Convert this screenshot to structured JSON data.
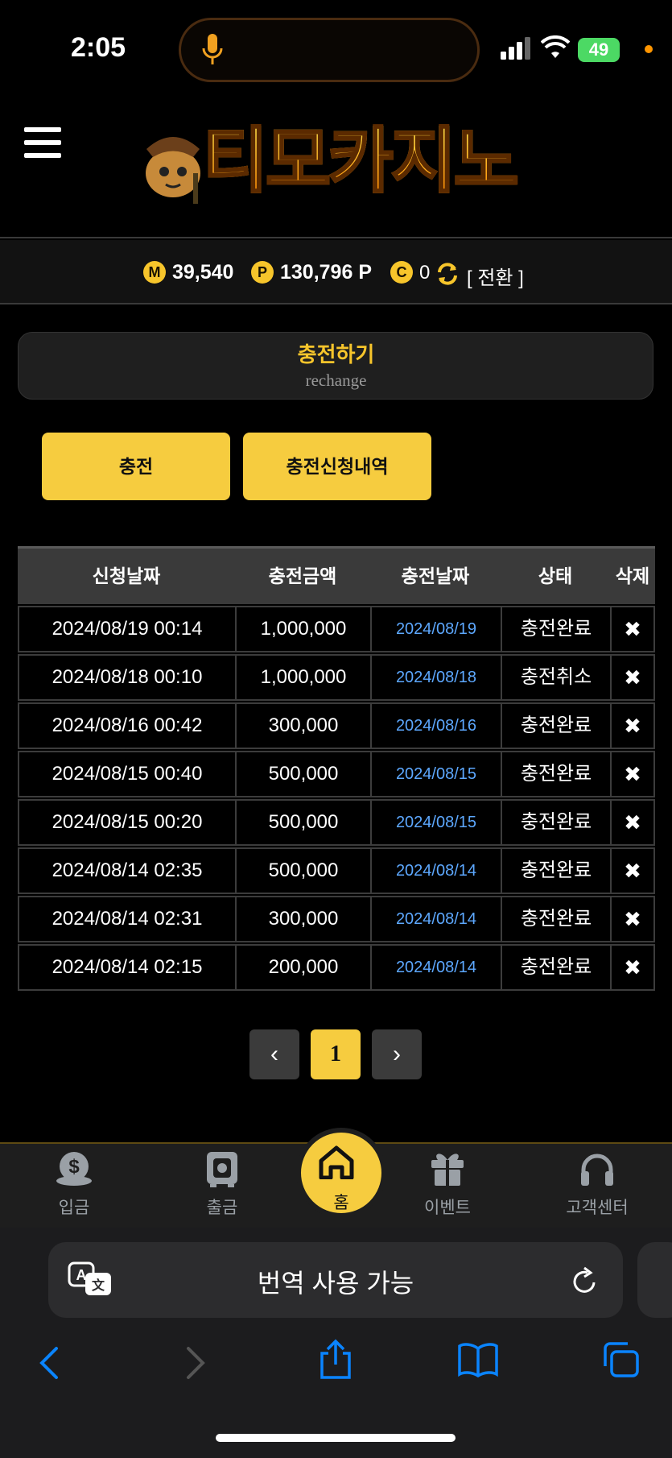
{
  "status": {
    "time": "2:05",
    "battery": "49"
  },
  "header": {
    "logo_text": "티모카지노"
  },
  "wallet": {
    "money_icon": "M",
    "money": "39,540",
    "point_icon": "P",
    "point": "130,796 P",
    "casino_icon": "C",
    "casino": "0",
    "convert": "[ 전환 ]"
  },
  "section": {
    "title": "충전하기",
    "subtitle": "rechange"
  },
  "buttons": {
    "charge": "충전",
    "history": "충전신청내역"
  },
  "table": {
    "headers": [
      "신청날짜",
      "충전금액",
      "충전날짜",
      "상태",
      "삭제"
    ],
    "rows": [
      {
        "req": "2024/08/19 00:14",
        "amount": "1,000,000",
        "date": "2024/08/19",
        "status": "충전완료"
      },
      {
        "req": "2024/08/18 00:10",
        "amount": "1,000,000",
        "date": "2024/08/18",
        "status": "충전취소"
      },
      {
        "req": "2024/08/16 00:42",
        "amount": "300,000",
        "date": "2024/08/16",
        "status": "충전완료"
      },
      {
        "req": "2024/08/15 00:40",
        "amount": "500,000",
        "date": "2024/08/15",
        "status": "충전완료"
      },
      {
        "req": "2024/08/15 00:20",
        "amount": "500,000",
        "date": "2024/08/15",
        "status": "충전완료"
      },
      {
        "req": "2024/08/14 02:35",
        "amount": "500,000",
        "date": "2024/08/14",
        "status": "충전완료"
      },
      {
        "req": "2024/08/14 02:31",
        "amount": "300,000",
        "date": "2024/08/14",
        "status": "충전완료"
      },
      {
        "req": "2024/08/14 02:15",
        "amount": "200,000",
        "date": "2024/08/14",
        "status": "충전완료"
      }
    ],
    "delete_glyph": "✖"
  },
  "pagination": {
    "prev": "‹",
    "current": "1",
    "next": "›"
  },
  "bottom_nav": {
    "deposit": "입금",
    "withdraw": "출금",
    "home": "홈",
    "event": "이벤트",
    "support": "고객센터"
  },
  "safari": {
    "translate": "번역 사용 가능"
  },
  "colors": {
    "accent": "#f6cc3f",
    "link": "#5da8ff",
    "ios_blue": "#0a84ff"
  }
}
